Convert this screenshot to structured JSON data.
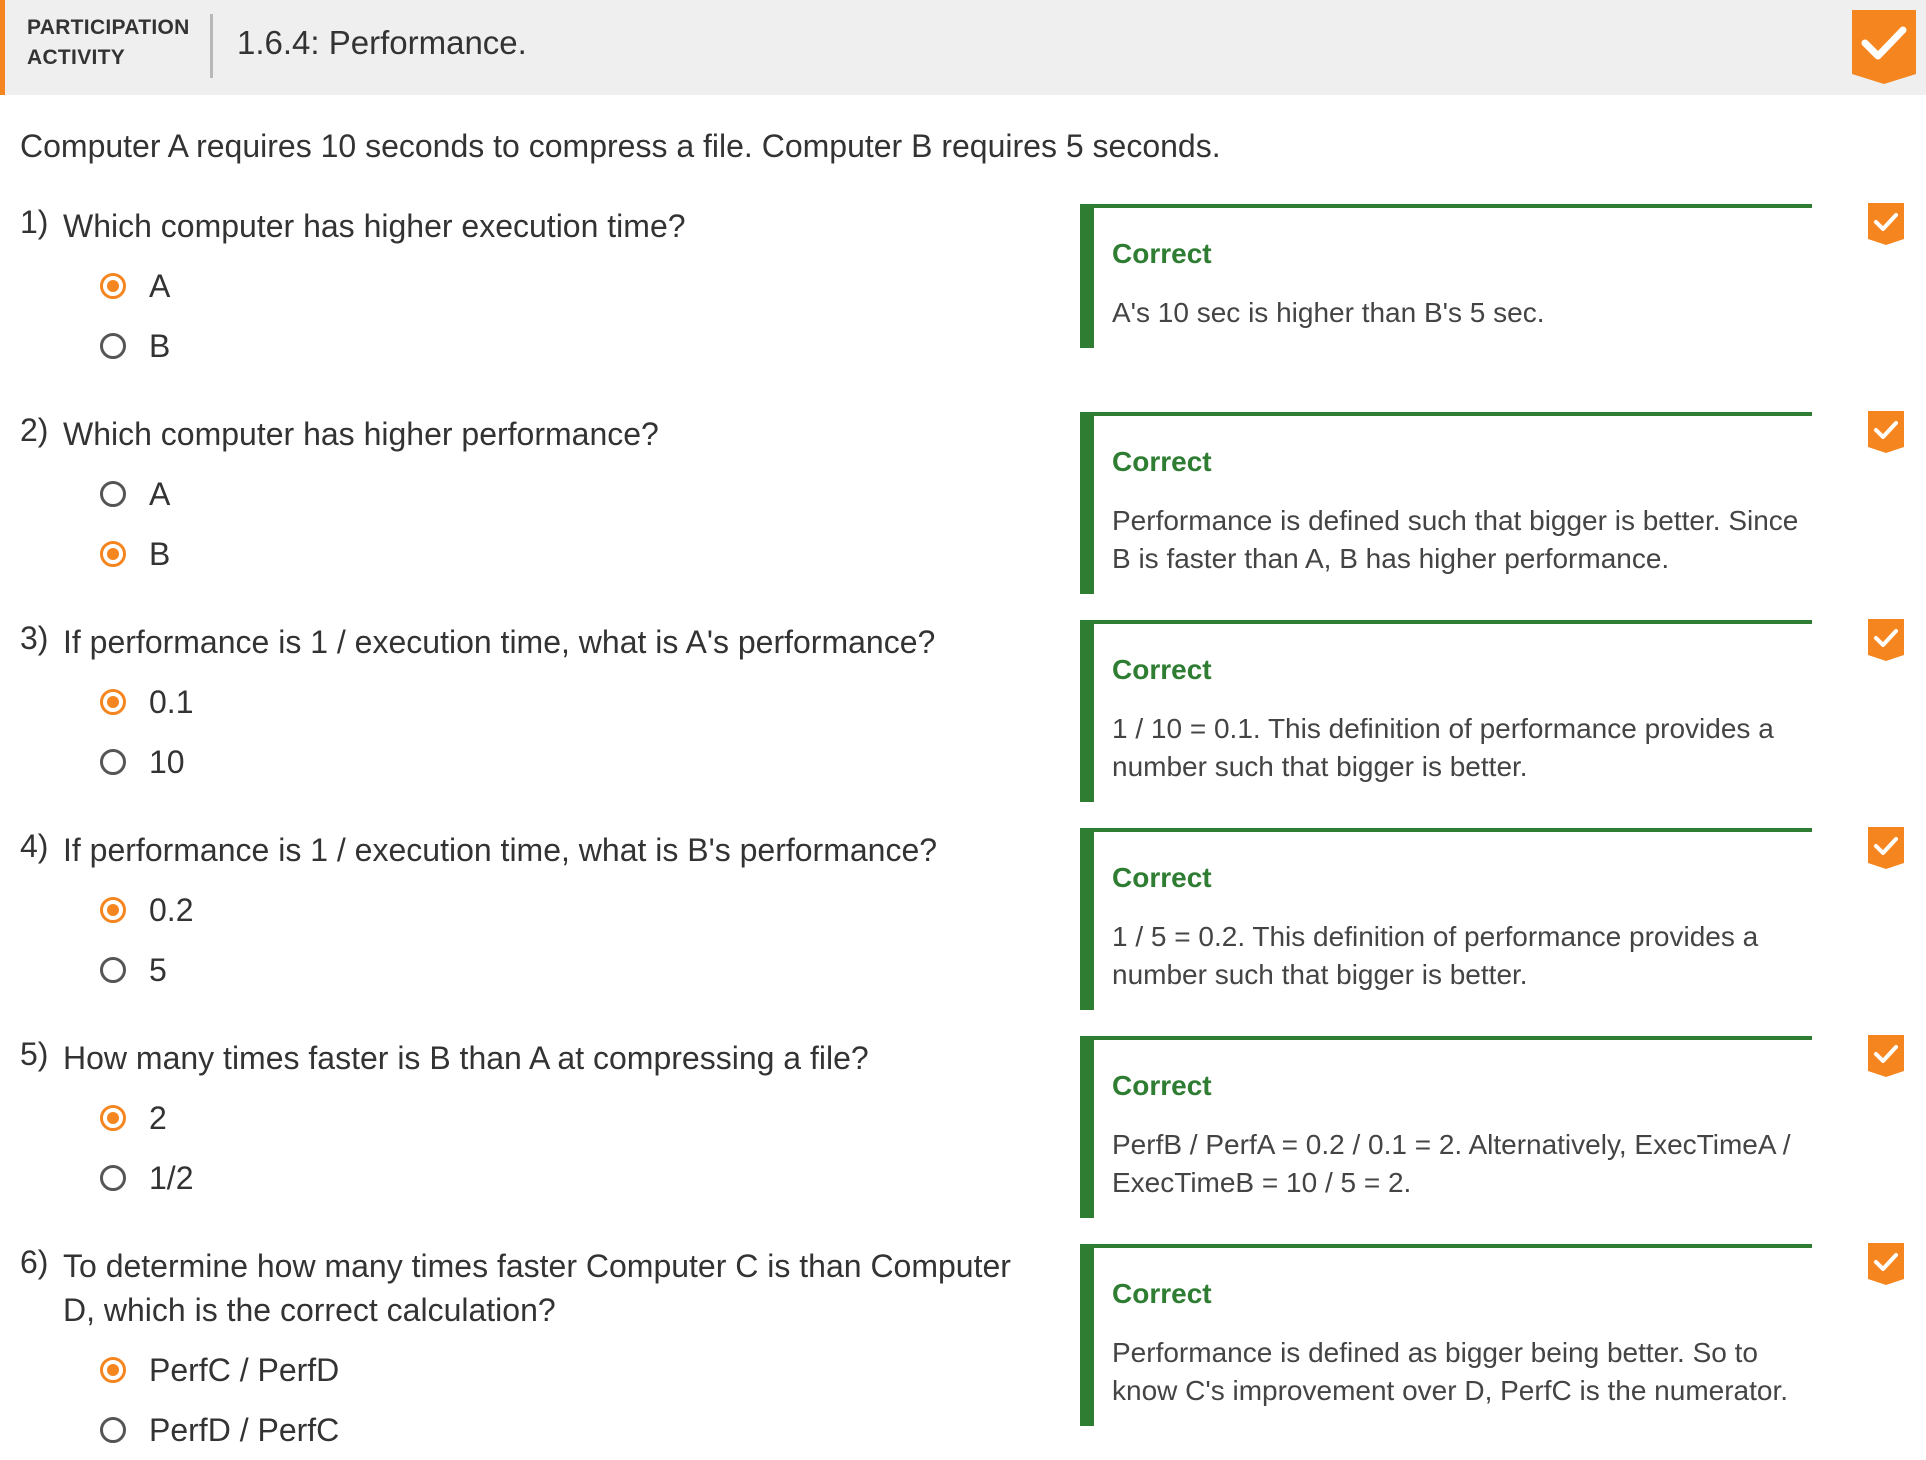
{
  "header": {
    "kind_line1": "PARTICIPATION",
    "kind_line2": "ACTIVITY",
    "title": "1.6.4: Performance.",
    "accent_color": "#f5861f",
    "completion_icon": "check-badge-icon"
  },
  "intro": "Computer A requires 10 seconds to compress a file. Computer B requires 5 seconds.",
  "questions": [
    {
      "number": "1)",
      "text": "Which computer has higher execution time?",
      "options": [
        {
          "label": "A",
          "selected": true
        },
        {
          "label": "B",
          "selected": false
        }
      ],
      "feedback_status": "Correct",
      "feedback_text": "A's 10 sec is higher than B's 5 sec."
    },
    {
      "number": "2)",
      "text": "Which computer has higher performance?",
      "options": [
        {
          "label": "A",
          "selected": false
        },
        {
          "label": "B",
          "selected": true
        }
      ],
      "feedback_status": "Correct",
      "feedback_text": "Performance is defined such that bigger is better. Since B is faster than A, B has higher performance."
    },
    {
      "number": "3)",
      "text": "If performance is 1 / execution time, what is A's performance?",
      "options": [
        {
          "label": "0.1",
          "selected": true
        },
        {
          "label": "10",
          "selected": false
        }
      ],
      "feedback_status": "Correct",
      "feedback_text": "1 / 10 = 0.1. This definition of performance provides a number such that bigger is better."
    },
    {
      "number": "4)",
      "text": "If performance is 1 / execution time, what is B's performance?",
      "options": [
        {
          "label": "0.2",
          "selected": true
        },
        {
          "label": "5",
          "selected": false
        }
      ],
      "feedback_status": "Correct",
      "feedback_text": "1 / 5 = 0.2. This definition of performance provides a number such that bigger is better."
    },
    {
      "number": "5)",
      "text": "How many times faster is B than A at compressing a file?",
      "options": [
        {
          "label": "2",
          "selected": true
        },
        {
          "label": "1/2",
          "selected": false
        }
      ],
      "feedback_status": "Correct",
      "feedback_text": "PerfB / PerfA = 0.2 / 0.1 = 2. Alternatively, ExecTimeA / ExecTimeB = 10 / 5 = 2."
    },
    {
      "number": "6)",
      "text": "To determine how many times faster Computer C is than Computer D, which is the correct calculation?",
      "options": [
        {
          "label": "PerfC / PerfD",
          "selected": true
        },
        {
          "label": "PerfD / PerfC",
          "selected": false
        }
      ],
      "feedback_status": "Correct",
      "feedback_text": "Performance is defined as bigger being better. So to know C's improvement over D, PerfC is the numerator."
    }
  ],
  "colors": {
    "accent": "#f5861f",
    "correct": "#2e7d32",
    "header_bg": "#efefef"
  }
}
